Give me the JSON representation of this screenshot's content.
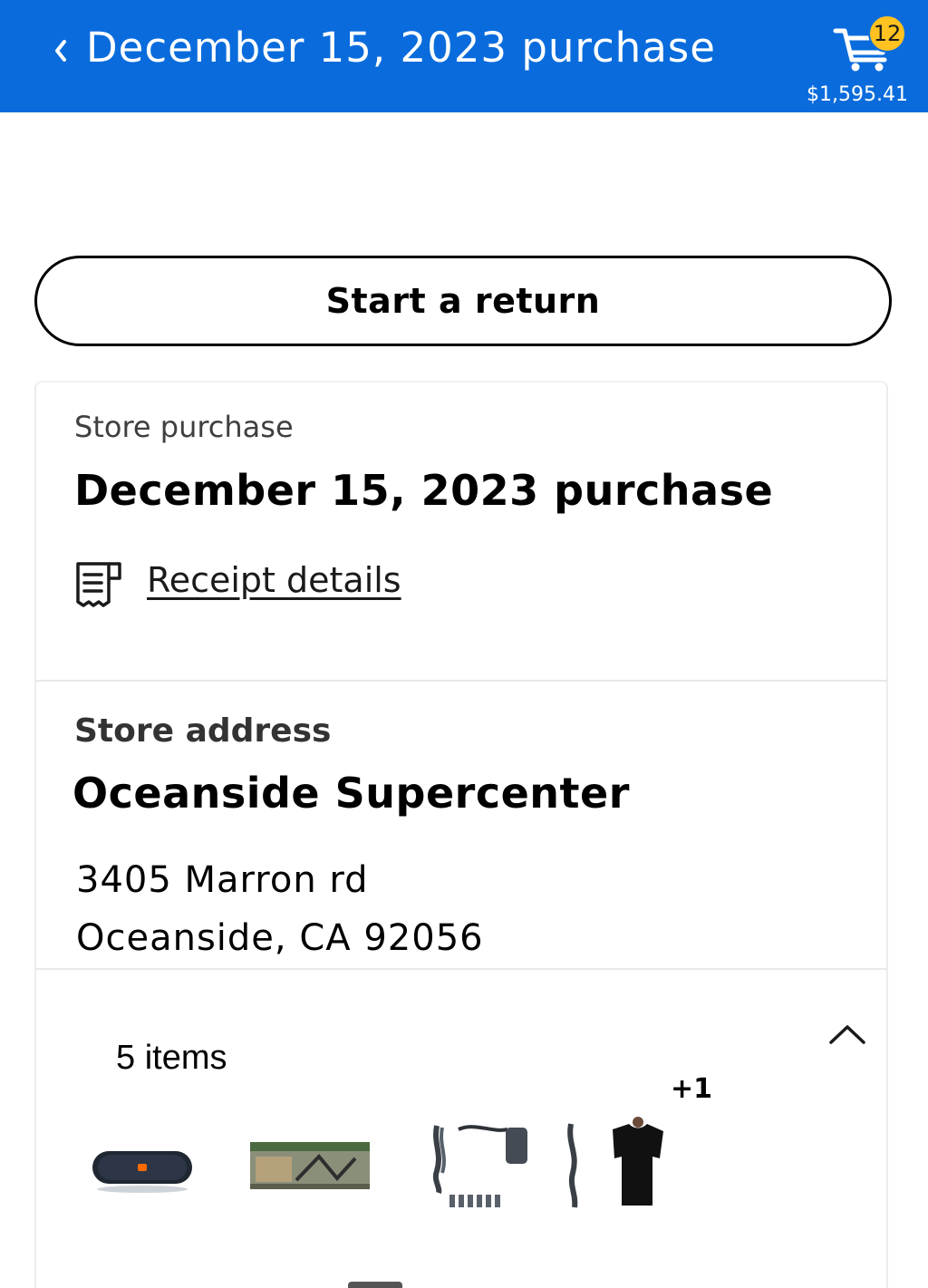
{
  "header": {
    "title": "December 15, 2023 purchase",
    "cart_count": "12",
    "cart_total": "$1,595.41",
    "background_color": "#0a6cdc",
    "badge_color": "#ffc220"
  },
  "actions": {
    "start_return_label": "Start a return"
  },
  "purchase": {
    "type_label": "Store purchase",
    "title": "December 15, 2023 purchase",
    "receipt_link_label": "Receipt details"
  },
  "store": {
    "section_label": "Store address",
    "name": "Oceanside Supercenter",
    "address_line1": "3405 Marron rd",
    "address_line2": "Oceanside, CA 92056"
  },
  "items": {
    "count_label": "5 items",
    "more_label": "+1",
    "thumbnails": [
      "speaker-image",
      "boxed-product-image",
      "power-adapter-image",
      "t-shirt-image"
    ]
  },
  "icons": {
    "back": "chevron-left-icon",
    "cart": "cart-icon",
    "receipt": "receipt-icon",
    "collapse": "chevron-up-icon"
  }
}
